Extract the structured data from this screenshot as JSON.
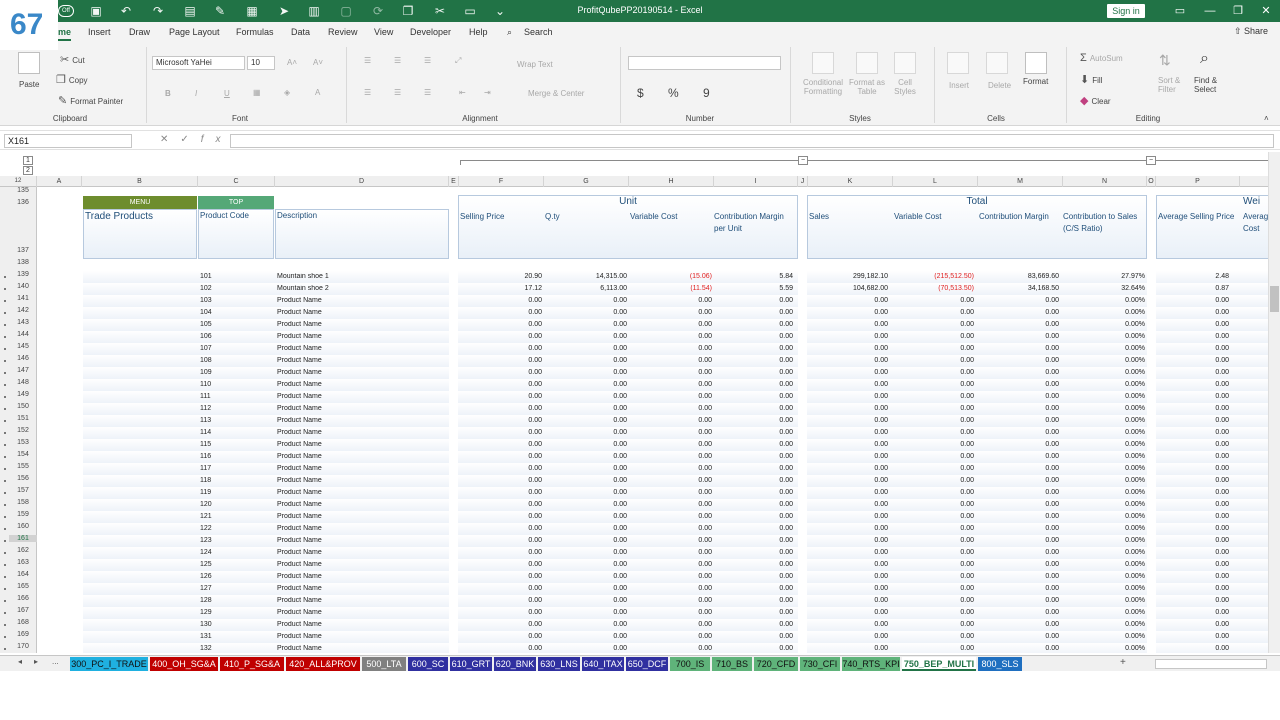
{
  "app": {
    "title": "ProfitQubePP20190514 - Excel",
    "sign_in": "Sign in",
    "share": "Share",
    "badge": "67",
    "autosave": "Off"
  },
  "icons": [
    "save-icon",
    "undo-icon",
    "redo-icon",
    "form-icon",
    "paint-icon",
    "table-icon",
    "send-icon",
    "calc-icon",
    "camera-icon",
    "sync-icon",
    "copy-icon",
    "cut-icon",
    "paste-icon",
    "more-icon"
  ],
  "ribbon_tabs": [
    "me",
    "Insert",
    "Draw",
    "Page Layout",
    "Formulas",
    "Data",
    "Review",
    "View",
    "Developer",
    "Help"
  ],
  "search": "Search",
  "clipboard": {
    "paste": "Paste",
    "cut": "Cut",
    "copy": "Copy",
    "format_painter": "Format Painter",
    "label": "Clipboard"
  },
  "font": {
    "name": "Microsoft YaHei",
    "size": "10",
    "label": "Font",
    "bold": "B",
    "italic": "I",
    "underline": "U"
  },
  "alignment": {
    "wrap": "Wrap Text",
    "merge": "Merge & Center",
    "label": "Alignment"
  },
  "number": {
    "format": "",
    "currency": "$",
    "percent": "%",
    "comma": "9",
    "label": "Number"
  },
  "styles": {
    "cond": "Conditional Formatting",
    "table": "Format as Table",
    "cell": "Cell Styles",
    "label": "Styles"
  },
  "cells": {
    "insert": "Insert",
    "delete": "Delete",
    "format": "Format",
    "label": "Cells"
  },
  "editing": {
    "autosum": "AutoSum",
    "fill": "Fill",
    "clear": "Clear",
    "sort": "Sort & Filter",
    "find": "Find & Select",
    "label": "Editing"
  },
  "formula_bar": {
    "name_box": "X161",
    "value": "",
    "fx": "fx"
  },
  "outline": {
    "levels": [
      "1",
      "2"
    ],
    "row_levels": "12",
    "collapse": "−"
  },
  "columns": [
    "A",
    "B",
    "C",
    "D",
    "E",
    "F",
    "G",
    "H",
    "I",
    "J",
    "K",
    "L",
    "M",
    "N",
    "O",
    "P"
  ],
  "row_numbers": [
    "135",
    "136",
    "137",
    "138",
    "139",
    "140",
    "141",
    "142",
    "143",
    "144",
    "145",
    "146",
    "147",
    "148",
    "149",
    "150",
    "151",
    "152",
    "153",
    "154",
    "155",
    "156",
    "157",
    "158",
    "159",
    "160",
    "161",
    "162",
    "163",
    "164",
    "165",
    "166",
    "167",
    "168",
    "169",
    "170"
  ],
  "sheet": {
    "menu_btn": "MENU",
    "top_btn": "TOP",
    "section_title": "Trade Products",
    "headers": {
      "product_code": "Product Code",
      "description": "Description",
      "unit": "Unit",
      "total": "Total",
      "weighted": "Wei",
      "unit_cols": [
        "Selling Price",
        "Q.ty",
        "Variable Cost",
        "Contribution Margin per Unit"
      ],
      "total_cols": [
        "Sales",
        "Variable Cost",
        "Contribution Margin",
        "Contribution to Sales (C/S Ratio)"
      ],
      "w_cols": [
        "Average Selling Price",
        "Average Cost"
      ]
    },
    "rows": [
      {
        "code": "101",
        "desc": "Mountain shoe 1",
        "sp": "20.90",
        "qty": "14,315.00",
        "vc": "(15.06)",
        "cm": "5.84",
        "sales": "299,182.10",
        "tvc": "(215,512.50)",
        "tcm": "83,669.60",
        "cs": "27.97%",
        "asp": "2.48"
      },
      {
        "code": "102",
        "desc": "Mountain shoe 2",
        "sp": "17.12",
        "qty": "6,113.00",
        "vc": "(11.54)",
        "cm": "5.59",
        "sales": "104,682.00",
        "tvc": "(70,513.50)",
        "tcm": "34,168.50",
        "cs": "32.64%",
        "asp": "0.87"
      },
      {
        "code": "103",
        "desc": "Product Name"
      },
      {
        "code": "104",
        "desc": "Product Name"
      },
      {
        "code": "105",
        "desc": "Product Name"
      },
      {
        "code": "106",
        "desc": "Product Name"
      },
      {
        "code": "107",
        "desc": "Product Name"
      },
      {
        "code": "108",
        "desc": "Product Name"
      },
      {
        "code": "109",
        "desc": "Product Name"
      },
      {
        "code": "110",
        "desc": "Product Name"
      },
      {
        "code": "111",
        "desc": "Product Name"
      },
      {
        "code": "112",
        "desc": "Product Name"
      },
      {
        "code": "113",
        "desc": "Product Name"
      },
      {
        "code": "114",
        "desc": "Product Name"
      },
      {
        "code": "115",
        "desc": "Product Name"
      },
      {
        "code": "116",
        "desc": "Product Name"
      },
      {
        "code": "117",
        "desc": "Product Name"
      },
      {
        "code": "118",
        "desc": "Product Name"
      },
      {
        "code": "119",
        "desc": "Product Name"
      },
      {
        "code": "120",
        "desc": "Product Name"
      },
      {
        "code": "121",
        "desc": "Product Name"
      },
      {
        "code": "122",
        "desc": "Product Name"
      },
      {
        "code": "123",
        "desc": "Product Name"
      },
      {
        "code": "124",
        "desc": "Product Name"
      },
      {
        "code": "125",
        "desc": "Product Name"
      },
      {
        "code": "126",
        "desc": "Product Name"
      },
      {
        "code": "127",
        "desc": "Product Name"
      },
      {
        "code": "128",
        "desc": "Product Name"
      },
      {
        "code": "129",
        "desc": "Product Name"
      },
      {
        "code": "130",
        "desc": "Product Name"
      },
      {
        "code": "131",
        "desc": "Product Name"
      },
      {
        "code": "132",
        "desc": "Product Name"
      }
    ],
    "zero": "0.00",
    "zero_pct": "0.00%"
  },
  "sheet_tabs": [
    {
      "name": "300_PC_I_TRADE",
      "color": "#1fb0e0"
    },
    {
      "name": "400_OH_SG&A",
      "color": "#c00000"
    },
    {
      "name": "410_P_SG&A",
      "color": "#c00000"
    },
    {
      "name": "420_ALL&PROV",
      "color": "#c00000"
    },
    {
      "name": "500_LTA",
      "color": "#808080"
    },
    {
      "name": "600_SC",
      "color": "#3030a0"
    },
    {
      "name": "610_GRT",
      "color": "#3030a0"
    },
    {
      "name": "620_BNK",
      "color": "#3030a0"
    },
    {
      "name": "630_LNS",
      "color": "#3030a0"
    },
    {
      "name": "640_ITAX",
      "color": "#3030a0"
    },
    {
      "name": "650_DCF",
      "color": "#3030a0"
    },
    {
      "name": "700_IS",
      "color": "#5fb37a"
    },
    {
      "name": "710_BS",
      "color": "#5fb37a"
    },
    {
      "name": "720_CFD",
      "color": "#5fb37a"
    },
    {
      "name": "730_CFI",
      "color": "#5fb37a"
    },
    {
      "name": "740_RTS_KPI",
      "color": "#5fb37a"
    },
    {
      "name": "750_BEP_MULTI",
      "color": "#ffffff"
    },
    {
      "name": "800_SLS",
      "color": "#1f6fc0"
    }
  ],
  "sheet_nav": {
    "prev": "◂",
    "next": "▸",
    "more": "...",
    "add": "+"
  }
}
